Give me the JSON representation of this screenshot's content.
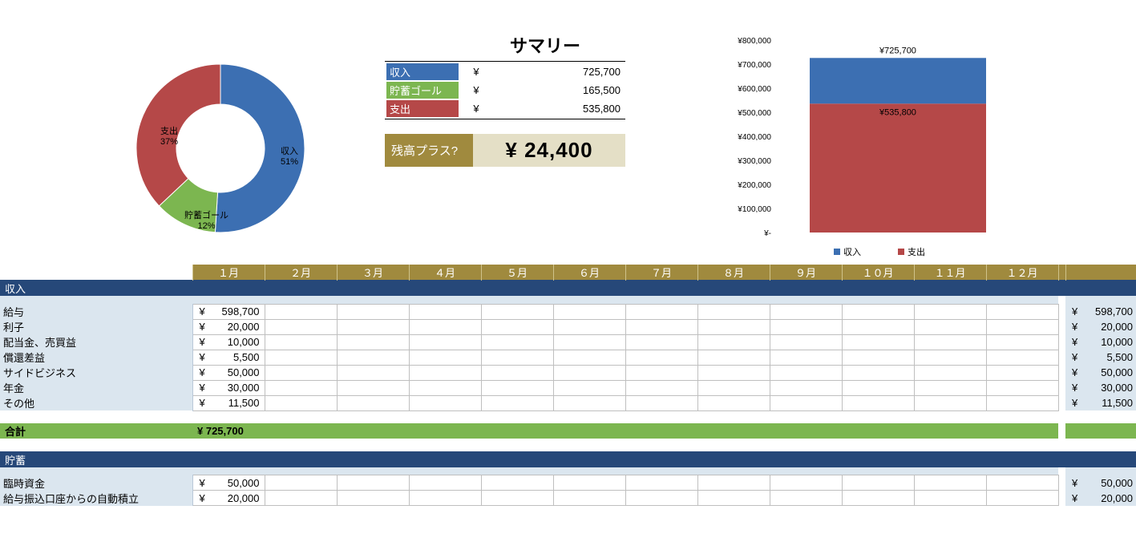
{
  "summary": {
    "title": "サマリー",
    "rows": [
      {
        "label": "収入",
        "value": "725,700"
      },
      {
        "label": "貯蓄ゴール",
        "value": "165,500"
      },
      {
        "label": "支出",
        "value": "535,800"
      }
    ],
    "balance_label": "残高プラス?",
    "balance_value": "¥ 24,400"
  },
  "donut": {
    "slices": [
      {
        "name": "収入",
        "pct": 51,
        "color": "#3c6fb2"
      },
      {
        "name": "貯蓄ゴール",
        "pct": 12,
        "color": "#7cb650"
      },
      {
        "name": "支出",
        "pct": 37,
        "color": "#b54848"
      }
    ]
  },
  "bar_chart": {
    "axis_max": 800000,
    "axis_step": 100000,
    "series": [
      {
        "name": "収入",
        "value": 725700,
        "label": "¥725,700",
        "color": "#3c6fb2"
      },
      {
        "name": "支出",
        "value": 535800,
        "label": "¥535,800",
        "color": "#b54848"
      }
    ]
  },
  "chart_data": [
    {
      "type": "pie",
      "title": "",
      "series": [
        {
          "name": "収入",
          "value": 51
        },
        {
          "name": "貯蓄ゴール",
          "value": 12
        },
        {
          "name": "支出",
          "value": 37
        }
      ],
      "unit": "percent"
    },
    {
      "type": "bar",
      "categories": [
        ""
      ],
      "series": [
        {
          "name": "収入",
          "values": [
            725700
          ]
        },
        {
          "name": "支出",
          "values": [
            535800
          ]
        }
      ],
      "ylim": [
        0,
        800000
      ],
      "ylabel": "¥"
    }
  ],
  "months": [
    "１月",
    "２月",
    "３月",
    "４月",
    "５月",
    "６月",
    "７月",
    "８月",
    "９月",
    "１０月",
    "１１月",
    "１２月"
  ],
  "sections": [
    {
      "id": "income",
      "header": "収入",
      "rows": [
        {
          "label": "給与",
          "m1": "598,700",
          "total": "598,700"
        },
        {
          "label": "利子",
          "m1": "20,000",
          "total": "20,000"
        },
        {
          "label": "配当金、売買益",
          "m1": "10,000",
          "total": "10,000"
        },
        {
          "label": "償還差益",
          "m1": "5,500",
          "total": "5,500"
        },
        {
          "label": "サイドビジネス",
          "m1": "50,000",
          "total": "50,000"
        },
        {
          "label": "年金",
          "m1": "30,000",
          "total": "30,000"
        },
        {
          "label": "その他",
          "m1": "11,500",
          "total": "11,500"
        }
      ],
      "total_label": "合計",
      "total_value": "¥ 725,700"
    },
    {
      "id": "savings",
      "header": "貯蓄",
      "rows": [
        {
          "label": "臨時資金",
          "m1": "50,000",
          "total": "50,000"
        },
        {
          "label": "給与振込口座からの自動積立",
          "m1": "20,000",
          "total": "20,000"
        }
      ]
    }
  ]
}
